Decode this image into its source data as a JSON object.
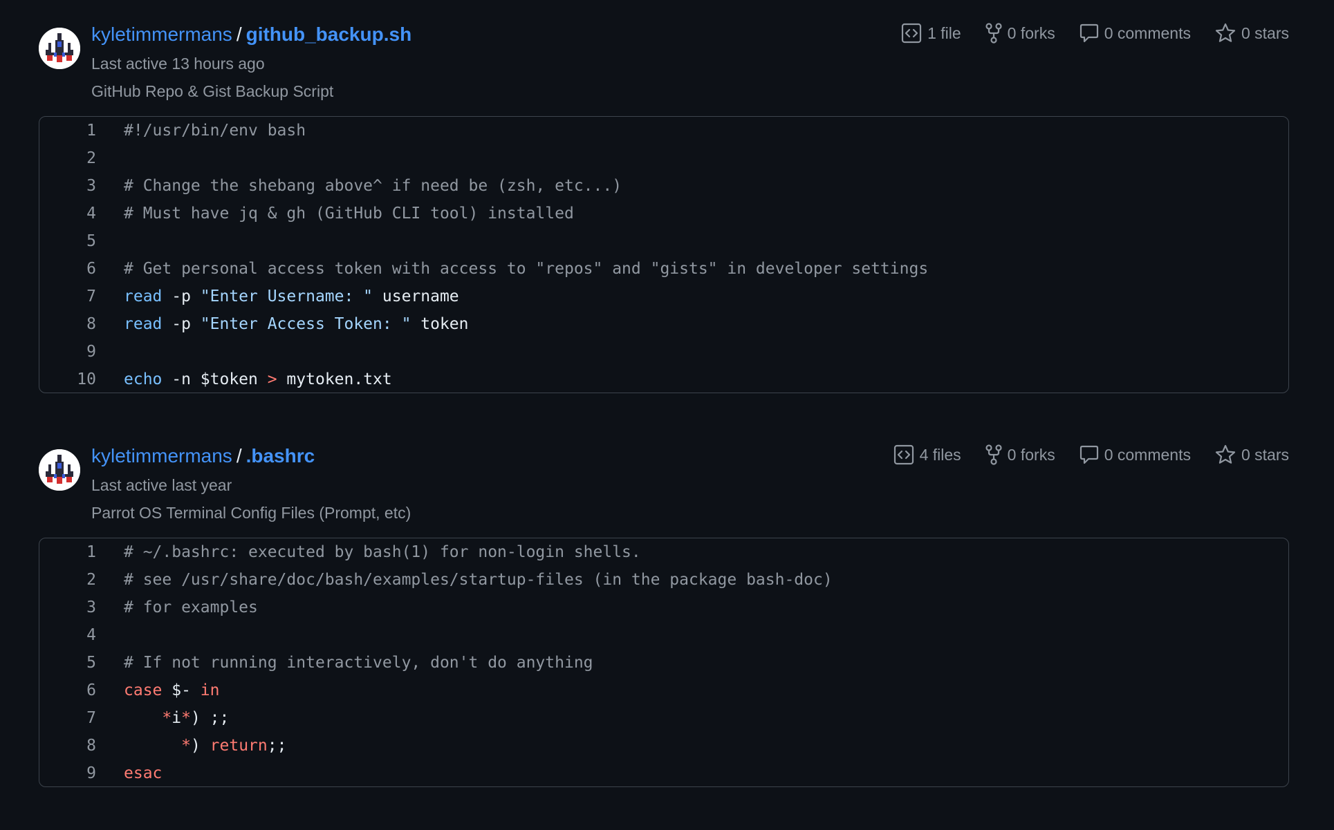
{
  "gists": [
    {
      "owner": "kyletimmermans",
      "separator": "/",
      "name": "github_backup.sh",
      "last_active": "Last active 13 hours ago",
      "description": "GitHub Repo & Gist Backup Script",
      "stats": {
        "files": "1 file",
        "forks": "0 forks",
        "comments": "0 comments",
        "stars": "0 stars"
      },
      "code": [
        {
          "n": "1",
          "t": [
            {
              "c": "comment",
              "s": "#!/usr/bin/env bash"
            }
          ]
        },
        {
          "n": "2",
          "t": []
        },
        {
          "n": "3",
          "t": [
            {
              "c": "comment",
              "s": "# Change the shebang above^ if need be (zsh, etc...)"
            }
          ]
        },
        {
          "n": "4",
          "t": [
            {
              "c": "comment",
              "s": "# Must have jq & gh (GitHub CLI tool) installed"
            }
          ]
        },
        {
          "n": "5",
          "t": []
        },
        {
          "n": "6",
          "t": [
            {
              "c": "comment",
              "s": "# Get personal access token with access to \"repos\" and \"gists\" in developer settings"
            }
          ]
        },
        {
          "n": "7",
          "t": [
            {
              "c": "builtin",
              "s": "read"
            },
            {
              "c": "plain",
              "s": " -p "
            },
            {
              "c": "string",
              "s": "\"Enter Username: \""
            },
            {
              "c": "plain",
              "s": " username"
            }
          ]
        },
        {
          "n": "8",
          "t": [
            {
              "c": "builtin",
              "s": "read"
            },
            {
              "c": "plain",
              "s": " -p "
            },
            {
              "c": "string",
              "s": "\"Enter Access Token: \""
            },
            {
              "c": "plain",
              "s": " token"
            }
          ]
        },
        {
          "n": "9",
          "t": []
        },
        {
          "n": "10",
          "t": [
            {
              "c": "builtin",
              "s": "echo"
            },
            {
              "c": "plain",
              "s": " -n $token "
            },
            {
              "c": "op",
              "s": ">"
            },
            {
              "c": "plain",
              "s": " mytoken.txt"
            }
          ]
        }
      ]
    },
    {
      "owner": "kyletimmermans",
      "separator": "/",
      "name": ".bashrc",
      "last_active": "Last active last year",
      "description": "Parrot OS Terminal Config Files (Prompt, etc)",
      "stats": {
        "files": "4 files",
        "forks": "0 forks",
        "comments": "0 comments",
        "stars": "0 stars"
      },
      "code": [
        {
          "n": "1",
          "t": [
            {
              "c": "comment",
              "s": "# ~/.bashrc: executed by bash(1) for non-login shells."
            }
          ]
        },
        {
          "n": "2",
          "t": [
            {
              "c": "comment",
              "s": "# see /usr/share/doc/bash/examples/startup-files (in the package bash-doc)"
            }
          ]
        },
        {
          "n": "3",
          "t": [
            {
              "c": "comment",
              "s": "# for examples"
            }
          ]
        },
        {
          "n": "4",
          "t": []
        },
        {
          "n": "5",
          "t": [
            {
              "c": "comment",
              "s": "# If not running interactively, don't do anything"
            }
          ]
        },
        {
          "n": "6",
          "t": [
            {
              "c": "keyword",
              "s": "case"
            },
            {
              "c": "plain",
              "s": " $- "
            },
            {
              "c": "keyword",
              "s": "in"
            }
          ]
        },
        {
          "n": "7",
          "t": [
            {
              "c": "plain",
              "s": "    "
            },
            {
              "c": "op",
              "s": "*"
            },
            {
              "c": "plain",
              "s": "i"
            },
            {
              "c": "op",
              "s": "*"
            },
            {
              "c": "plain",
              "s": ") ;;"
            }
          ]
        },
        {
          "n": "8",
          "t": [
            {
              "c": "plain",
              "s": "      "
            },
            {
              "c": "op",
              "s": "*"
            },
            {
              "c": "plain",
              "s": ") "
            },
            {
              "c": "keyword",
              "s": "return"
            },
            {
              "c": "plain",
              "s": ";;"
            }
          ]
        },
        {
          "n": "9",
          "t": [
            {
              "c": "keyword",
              "s": "esac"
            }
          ]
        }
      ]
    }
  ],
  "colors": {
    "background": "#0d1117",
    "link": "#4493f8",
    "muted": "#9198a1",
    "text": "#e6edf3",
    "border": "#3d444d",
    "syntax_builtin": "#79c0ff",
    "syntax_string": "#a5d6ff",
    "syntax_keyword": "#ff7b72"
  },
  "icons": {
    "files": "code-square-icon",
    "forks": "repo-forked-icon",
    "comments": "comment-icon",
    "stars": "star-icon",
    "avatar": "pixel-spaceship-avatar"
  }
}
